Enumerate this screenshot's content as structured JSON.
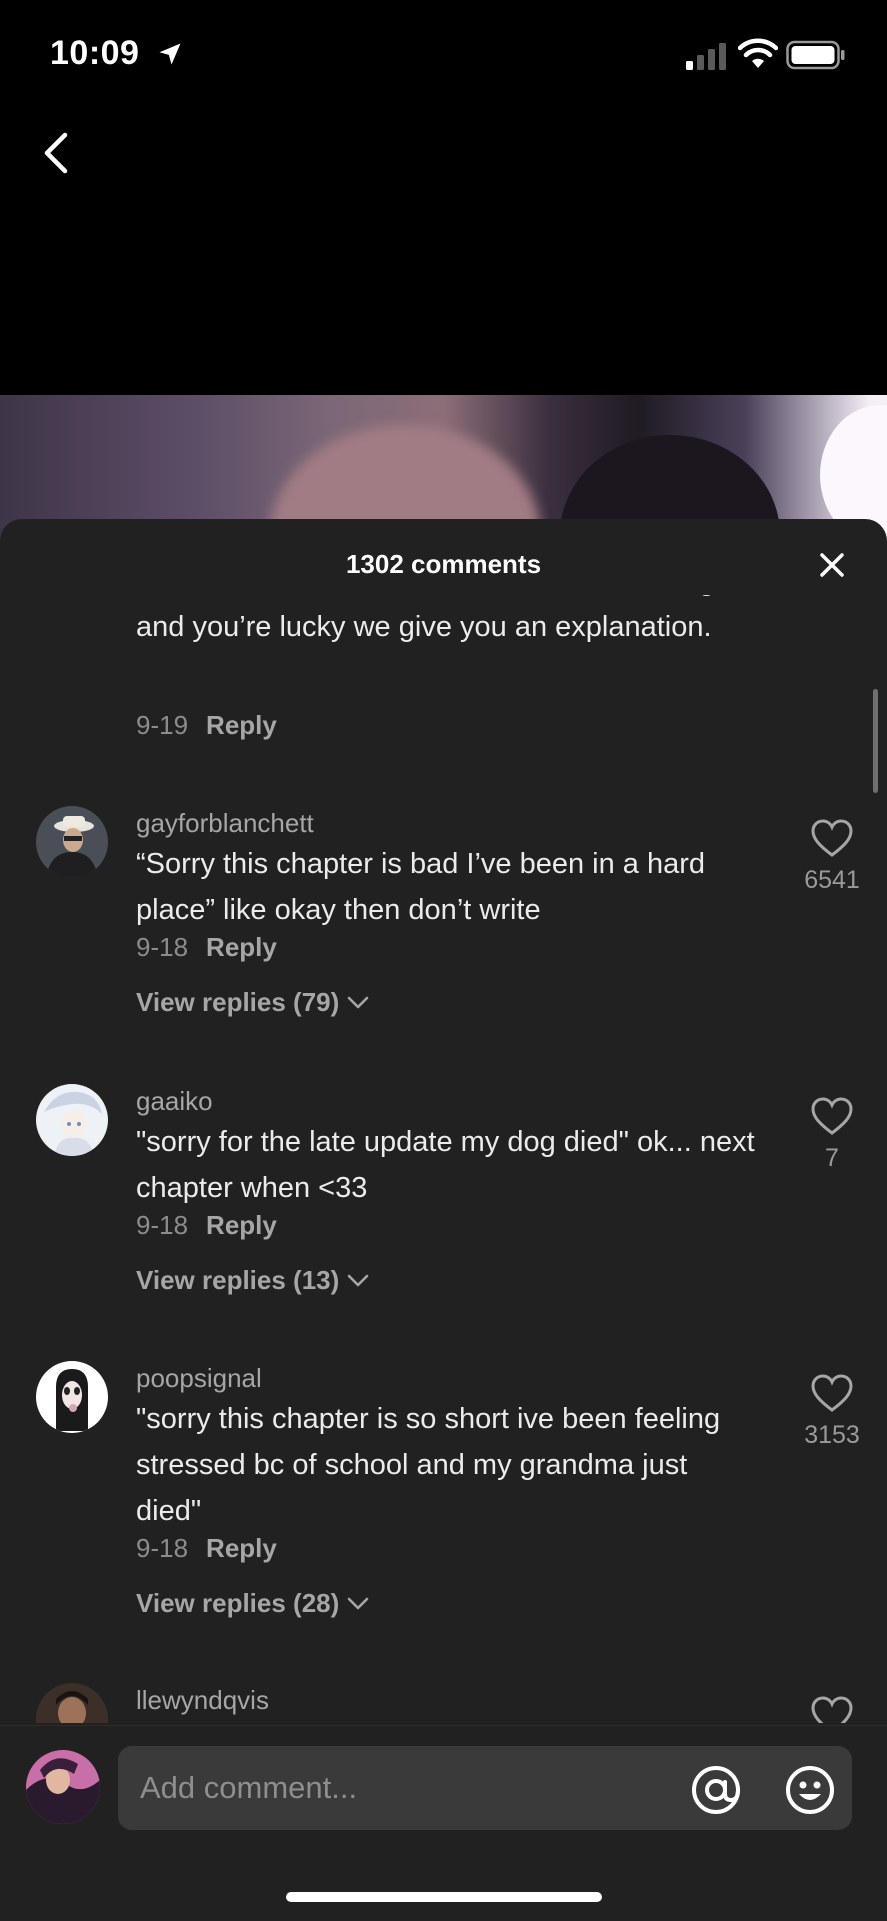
{
  "status_bar": {
    "time": "10:09"
  },
  "sheet": {
    "title": "1302 comments"
  },
  "comments": [
    {
      "username": "",
      "text": "Believe it or not, we need breaks from writing, and you’re lucky we give you an explanation.",
      "date": "9-19",
      "reply_label": "Reply"
    },
    {
      "username": "gayforblanchett",
      "text": "“Sorry this chapter is bad I’ve been in a hard place” like okay then don’t write",
      "date": "9-18",
      "reply_label": "Reply",
      "view_replies": "View replies (79)",
      "likes": "6541"
    },
    {
      "username": "gaaiko",
      "text": "\"sorry for the late update my dog died\" ok... next chapter when <33",
      "date": "9-18",
      "reply_label": "Reply",
      "view_replies": "View replies (13)",
      "likes": "7"
    },
    {
      "username": "poopsignal",
      "text": "\"sorry this chapter is so short ive been feeling stressed bc of school and my grandma just died\"",
      "date": "9-18",
      "reply_label": "Reply",
      "view_replies": "View replies (28)",
      "likes": "3153"
    },
    {
      "username": "llewyndqvis"
    }
  ],
  "composer": {
    "placeholder": "Add comment..."
  },
  "colors": {
    "sheet_bg": "#212121",
    "input_bg": "#3a3a3a",
    "secondary_text": "#a6a6a6"
  },
  "icons": [
    "location-arrow-icon",
    "signal-icon",
    "wifi-icon",
    "battery-icon",
    "back-chevron-icon",
    "close-icon",
    "heart-icon",
    "chevron-down-icon",
    "at-mention-icon",
    "emoji-icon"
  ]
}
